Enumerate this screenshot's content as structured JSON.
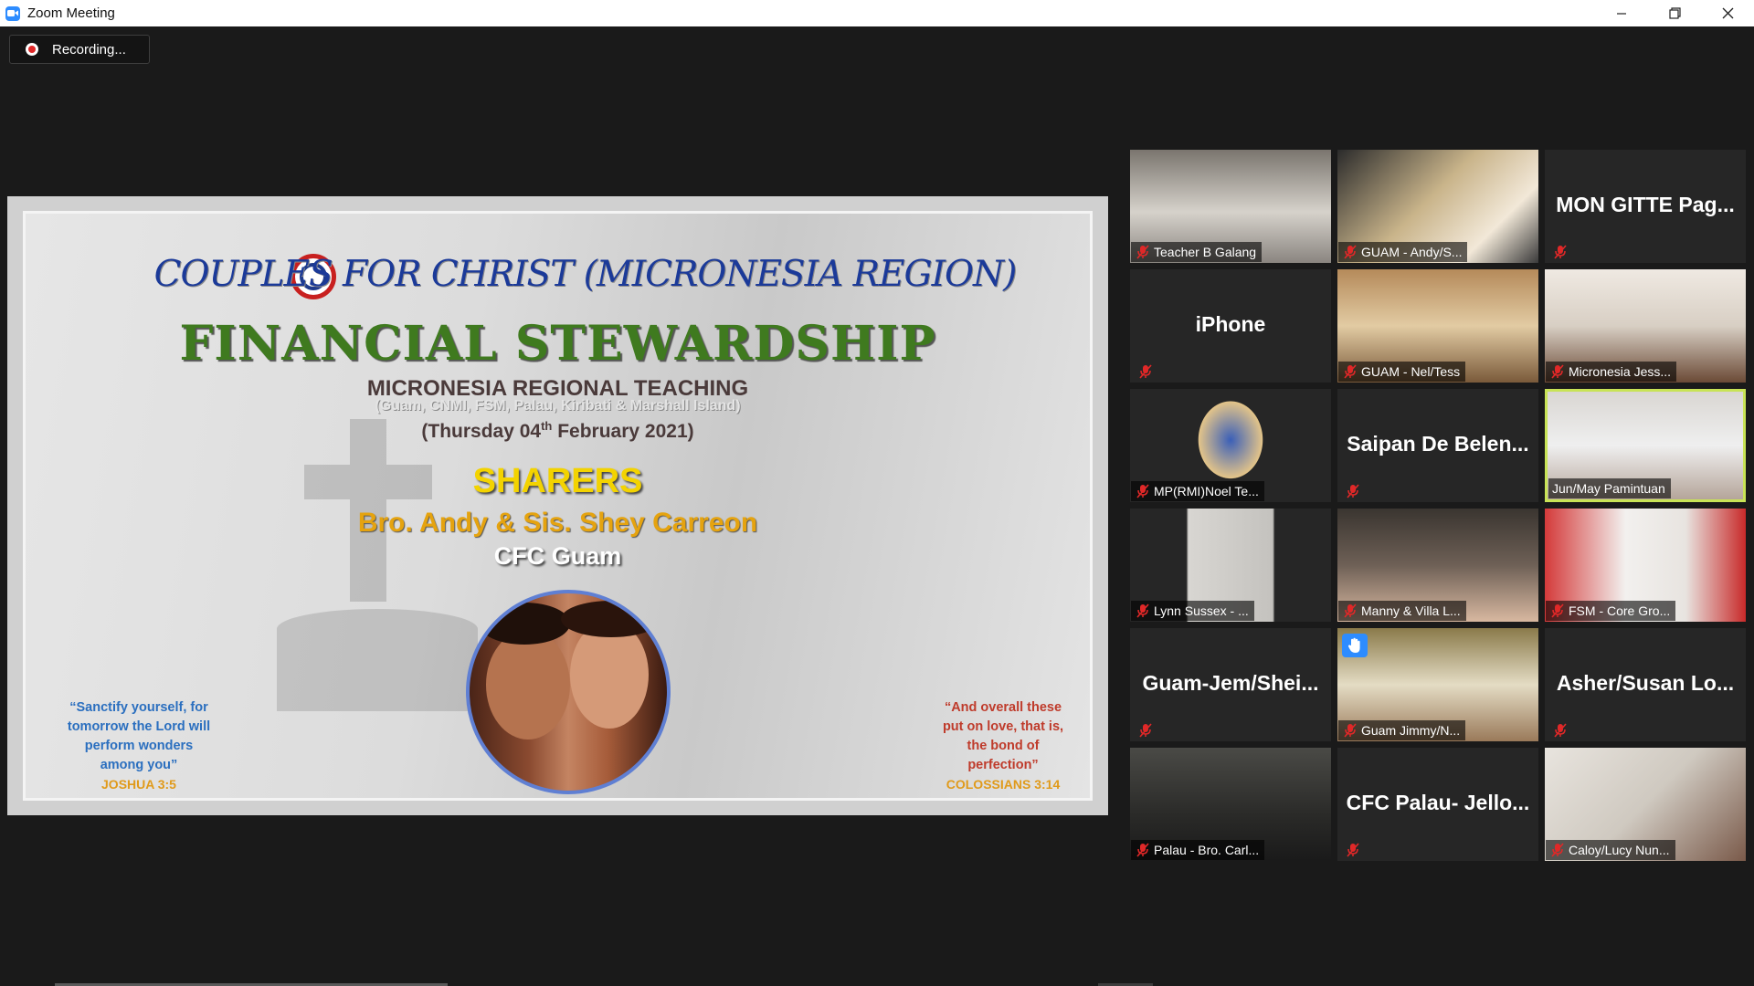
{
  "window": {
    "title": "Zoom Meeting",
    "controls": [
      "minimize",
      "restore",
      "close"
    ]
  },
  "recording": {
    "label": "Recording..."
  },
  "slide": {
    "org_title": "COUPLES FOR CHRIST (MICRONESIA REGION)",
    "main_title": "FINANCIAL STEWARDSHIP",
    "teaching_title": "MICRONESIA REGIONAL TEACHING",
    "places": "(Guam, CNMI, FSM, Palau, Kiribati & Marshall Island)",
    "date_prefix": "(Thursday 04",
    "date_sup": "th",
    "date_suffix": " February 2021)",
    "sharers_heading": "SHARERS",
    "sharer_names": "Bro. Andy & Sis. Shey Carreon",
    "sharer_group": "CFC Guam",
    "verse_left": {
      "line1": "“Sanctify yourself, for",
      "line2": "tomorrow the Lord will",
      "line3": "perform wonders",
      "line4": "among you”",
      "ref": "JOSHUA 3:5"
    },
    "verse_right": {
      "line1": "“And overall these",
      "line2": "put on love, that is,",
      "line3": "the bond of",
      "line4": "perfection”",
      "ref": "COLOSSIANS 3:14"
    }
  },
  "participants": [
    {
      "name": "Teacher B Galang",
      "video": true,
      "muted": true
    },
    {
      "name": "GUAM - Andy/S...",
      "video": true,
      "muted": true
    },
    {
      "name": "MON GITTE Pag...",
      "video": false,
      "muted": true
    },
    {
      "name": "iPhone",
      "video": false,
      "muted": true
    },
    {
      "name": "GUAM - Nel/Tess",
      "video": true,
      "muted": true
    },
    {
      "name": "Micronesia Jess...",
      "video": true,
      "muted": true
    },
    {
      "name": "MP(RMI)Noel Te...",
      "video": true,
      "muted": true
    },
    {
      "name": "Saipan De Belen...",
      "video": false,
      "muted": true
    },
    {
      "name": "Jun/May Pamintuan",
      "video": true,
      "muted": false,
      "active_speaker": true
    },
    {
      "name": "Lynn Sussex - ...",
      "video": true,
      "muted": true
    },
    {
      "name": "Manny & Villa L...",
      "video": true,
      "muted": true
    },
    {
      "name": "FSM - Core Gro...",
      "video": true,
      "muted": true
    },
    {
      "name": "Guam-Jem/Shei...",
      "video": false,
      "muted": true
    },
    {
      "name": "Guam Jimmy/N...",
      "video": true,
      "muted": true,
      "hand_raised": true
    },
    {
      "name": "Asher/Susan Lo...",
      "video": false,
      "muted": true
    },
    {
      "name": "Palau - Bro. Carl...",
      "video": true,
      "muted": true
    },
    {
      "name": "CFC Palau- Jello...",
      "video": false,
      "muted": true
    },
    {
      "name": "Caloy/Lucy Nun...",
      "video": true,
      "muted": true
    }
  ],
  "icons": {
    "mute": "microphone-muted-icon",
    "hand": "raised-hand-icon",
    "record": "record-dot-icon"
  },
  "colors": {
    "active_speaker_border": "#c8e356",
    "mute_red": "#e02828",
    "zoom_blue": "#2d8cff"
  }
}
